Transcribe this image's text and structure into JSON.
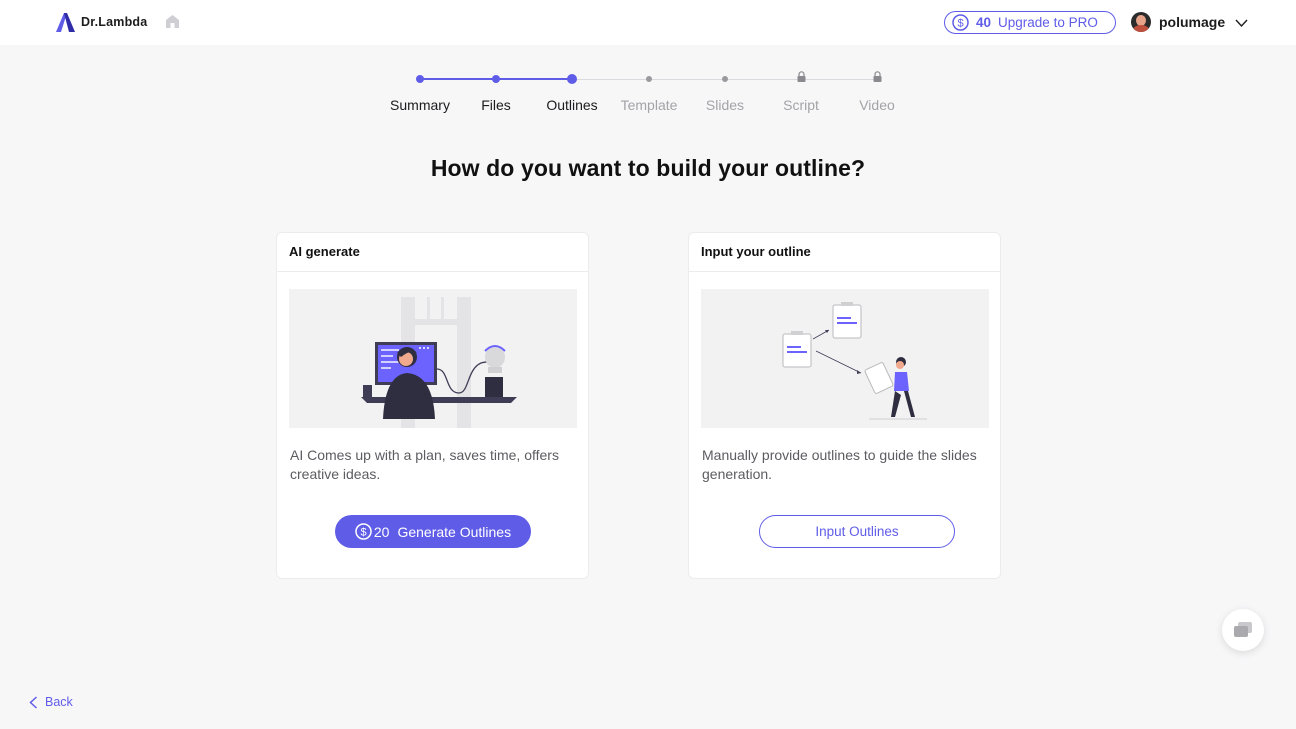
{
  "header": {
    "brand": "Dr.Lambda",
    "credits": "40",
    "upgrade_label": "Upgrade to PRO",
    "username": "polumage",
    "accent_color": "#5f5ce8"
  },
  "stepper": {
    "steps": [
      {
        "label": "Summary",
        "state": "done"
      },
      {
        "label": "Files",
        "state": "done"
      },
      {
        "label": "Outlines",
        "state": "active"
      },
      {
        "label": "Template",
        "state": "todo"
      },
      {
        "label": "Slides",
        "state": "todo"
      },
      {
        "label": "Script",
        "state": "locked"
      },
      {
        "label": "Video",
        "state": "locked"
      }
    ]
  },
  "main": {
    "headline": "How do you want to build your outline?",
    "cards": [
      {
        "title": "AI generate",
        "description": "AI Comes up with a plan, saves time, offers creative ideas.",
        "button_cost": "20",
        "button_label": "Generate Outlines"
      },
      {
        "title": "Input your outline",
        "description": "Manually provide outlines to guide the slides generation.",
        "button_label": "Input Outlines"
      }
    ]
  },
  "footer": {
    "back_label": "Back"
  },
  "icons": [
    "lambda-logo-icon",
    "home-icon",
    "coin-icon",
    "avatar",
    "chevron-down-icon",
    "lock-icon",
    "chat-icon",
    "chevron-left-icon"
  ]
}
